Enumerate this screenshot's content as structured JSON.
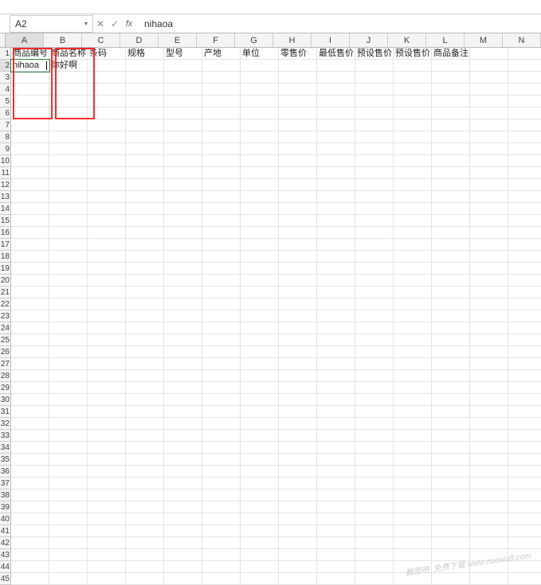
{
  "toolbar": {
    "items": [
      "",
      "",
      "",
      "",
      "",
      "",
      "",
      "",
      ""
    ]
  },
  "formula_bar": {
    "cell_ref": "A2",
    "value": "nihaoa"
  },
  "columns": [
    "A",
    "B",
    "C",
    "D",
    "E",
    "F",
    "G",
    "H",
    "I",
    "J",
    "K",
    "L",
    "M",
    "N"
  ],
  "headers_row": [
    "商品编号",
    "商品名称",
    "条码",
    "规格",
    "型号",
    "产地",
    "单位",
    "零售价",
    "最低售价",
    "预设售价",
    "预设售价",
    "商品备注",
    "",
    ""
  ],
  "data_rows": [
    [
      "nihaoa",
      "你好啊",
      "",
      "",
      "",
      "",
      "",
      "",
      "",
      "",
      "",
      "",
      "",
      ""
    ]
  ],
  "selected_col": "A",
  "selected_row": 2,
  "row_start": 1,
  "row_count": 45,
  "watermark": "截图吧_免费下载\nwww.zuoniu8.com"
}
